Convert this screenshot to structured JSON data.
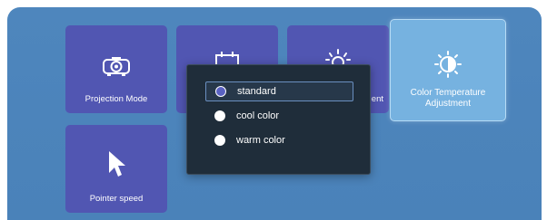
{
  "tiles": [
    {
      "label": "Projection Mode",
      "icon": "projector-icon"
    },
    {
      "label": "",
      "icon": "screen-frame-icon"
    },
    {
      "label": "ent",
      "icon": "brightness-icon"
    },
    {
      "label": "Color Temperature\nAdjustment",
      "icon": "color-temperature-icon"
    },
    {
      "label": "Pointer speed",
      "icon": "pointer-arrow-icon"
    }
  ],
  "popup": {
    "options": [
      {
        "label": "standard",
        "selected": true
      },
      {
        "label": "cool color",
        "selected": false
      },
      {
        "label": "warm color",
        "selected": false
      }
    ]
  },
  "colors": {
    "background": "#4e86bd",
    "tile": "#5156b2",
    "tile_selected": "#76b2e0",
    "popup": "#1f2d3a",
    "radio_selected": "#5a62c2"
  }
}
